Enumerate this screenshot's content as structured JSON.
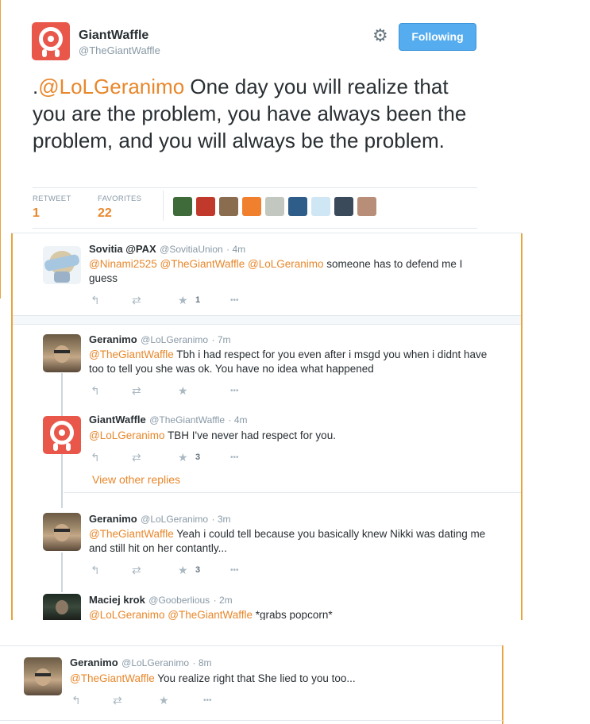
{
  "main_tweet": {
    "author_name": "GiantWaffle",
    "author_handle": "@TheGiantWaffle",
    "follow_button": "Following",
    "text_prefix": ".",
    "text_mention": "@LoLGeranimo",
    "text_body": " One day you will realize that you are the problem,  you have always been the problem, and you will always be the problem.",
    "retweet_label": "RETWEET",
    "retweet_count": "1",
    "favorites_label": "FAVORITES",
    "favorites_count": "22",
    "favoriter_colors": [
      "#3f6b3a",
      "#c0392b",
      "#8a6d4e",
      "#f07f2e",
      "#c2c8bf",
      "#2f5d8a",
      "#cfe7f5",
      "#3b4a5a",
      "#b98e78"
    ]
  },
  "replies": [
    {
      "name": "Sovitia @PAX",
      "handle": "@SovitiaUnion",
      "time": "· 4m",
      "mentions": "@Ninami2525 @TheGiantWaffle @LoLGeranimo",
      "text": " someone has to defend me I guess",
      "fav_count": "1"
    },
    {
      "name": "Geranimo",
      "handle": "@LoLGeranimo",
      "time": "· 7m",
      "mentions": "@TheGiantWaffle",
      "text": " Tbh i had respect for you even after i msgd you when i didnt have too to tell you she was ok. You have no idea what happened",
      "fav_count": ""
    },
    {
      "name": "GiantWaffle",
      "handle": "@TheGiantWaffle",
      "time": "· 4m",
      "mentions": "@LoLGeranimo",
      "text": " TBH I've never had respect for you.",
      "fav_count": "3"
    },
    {
      "name": "Geranimo",
      "handle": "@LoLGeranimo",
      "time": "· 3m",
      "mentions": "@TheGiantWaffle",
      "text": " Yeah i could tell because you basically knew Nikki was dating me and still hit on her contantly...",
      "fav_count": "3"
    },
    {
      "name": "Maciej krok",
      "handle": "@Gooberlious",
      "time": "· 2m",
      "mentions": "@LoLGeranimo @TheGiantWaffle",
      "text": " *grabs popcorn*",
      "fav_count": ""
    },
    {
      "name": "Geranimo",
      "handle": "@LoLGeranimo",
      "time": "· 8m",
      "mentions": "@TheGiantWaffle",
      "text": " You realize right that She lied to you too...",
      "fav_count": ""
    }
  ],
  "view_other_replies": "View other replies",
  "icons": {
    "reply": "↰",
    "retweet": "⇄",
    "favorite": "★",
    "more": "•••",
    "settings": "⚙"
  }
}
